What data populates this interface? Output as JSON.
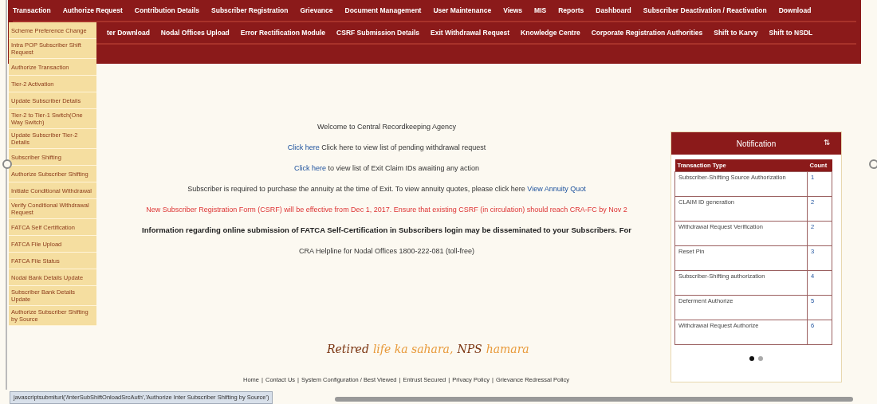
{
  "menu_row_1": [
    "Transaction",
    "Authorize Request",
    "Contribution Details",
    "Subscriber Registration",
    "Grievance",
    "Document Management",
    "User Maintenance",
    "Views",
    "MIS",
    "Reports",
    "Dashboard",
    "Subscriber Deactivation / Reactivation",
    "Download"
  ],
  "menu_row_2": [
    "ter Download",
    "Nodal Offices Upload",
    "Error Rectification Module",
    "CSRF Submission Details",
    "Exit Withdrawal Request",
    "Knowledge Centre",
    "Corporate Registration Authorities",
    "Shift to Karvy",
    "Shift to NSDL"
  ],
  "dropdown": [
    "Scheme Preference Change",
    "Intra POP Subscriber Shift Request",
    "Authorize Transaction",
    "Tier-2 Activation",
    "Update Subscriber Details",
    "Tier-2 to Tier-1 Switch(One Way Switch)",
    "Update Subscriber Tier-2 Details",
    "Subscriber Shifting",
    "Authorize Subscriber Shifting",
    "Initiate Conditional Withdrawal",
    "Verify Conditional Withdrawal Request",
    "FATCA Self Certification",
    "FATCA File Upload",
    "FATCA File Status",
    "Nodal Bank Details Update",
    "Subscriber Bank Details Update",
    "Authorize Subscriber Shifting by Source"
  ],
  "messages": [
    {
      "kind": "plain",
      "text": "Welcome to Central Recordkeeping Agency"
    },
    {
      "kind": "link_first",
      "link": "Click here",
      "text": "Click here to view list of pending withdrawal request"
    },
    {
      "kind": "link_first",
      "link": "Click here",
      "text": "to view list of Exit Claim IDs awaiting any action"
    },
    {
      "kind": "link_last",
      "text": "Subscriber is required to purchase the annuity at the time of Exit. To view annuity quotes, please click here",
      "link": "View Annuity Quot"
    },
    {
      "kind": "alert",
      "text": "New Subscriber Registration Form (CSRF) will be effective from Dec 1, 2017. Ensure that existing CSRF (in circulation) should reach CRA-FC by Nov 2"
    },
    {
      "kind": "bold",
      "text": "Information regarding online submission of FATCA Self-Certification in Subscribers login may be disseminated to your Subscribers. For"
    },
    {
      "kind": "plain",
      "text": "CRA Helpline for Nodal Offices 1800-222-081 (toll-free)"
    }
  ],
  "notification": {
    "title": "Notification",
    "sort_glyph": "⇅",
    "columns": [
      "Transaction Type",
      "Count"
    ],
    "rows": [
      {
        "type": "Subscriber-Shifting Source Authorization",
        "count": "1"
      },
      {
        "type": "CLAIM ID generation",
        "count": "2"
      },
      {
        "type": "Withdrawal Request Verification",
        "count": "2"
      },
      {
        "type": "Reset Pin",
        "count": "3"
      },
      {
        "type": "Subscriber-Shifting authorization",
        "count": "4"
      },
      {
        "type": "Deferment Authorize",
        "count": "5"
      },
      {
        "type": "Withdrawal Request Authorize",
        "count": "6"
      }
    ],
    "dots": [
      {
        "selected": true
      },
      {
        "selected": false
      }
    ]
  },
  "slogan": [
    {
      "kind": "dark",
      "text": "Retired"
    },
    {
      "kind": "accent",
      "text": "life ka sahara,"
    },
    {
      "kind": "dark",
      "text": "NPS"
    },
    {
      "kind": "accent",
      "text": "hamara"
    }
  ],
  "footer_links": [
    "Home",
    "Contact Us",
    "System Configuration / Best Viewed",
    "Entrust Secured",
    "Privacy Policy",
    "Grievance Redressal Policy"
  ],
  "footer_separator": "|",
  "status_url": "javascriptsubmiturl('/interSubShiftOnloadSrcAuth','Authorize Inter Subscriber Shifting by Source')"
}
